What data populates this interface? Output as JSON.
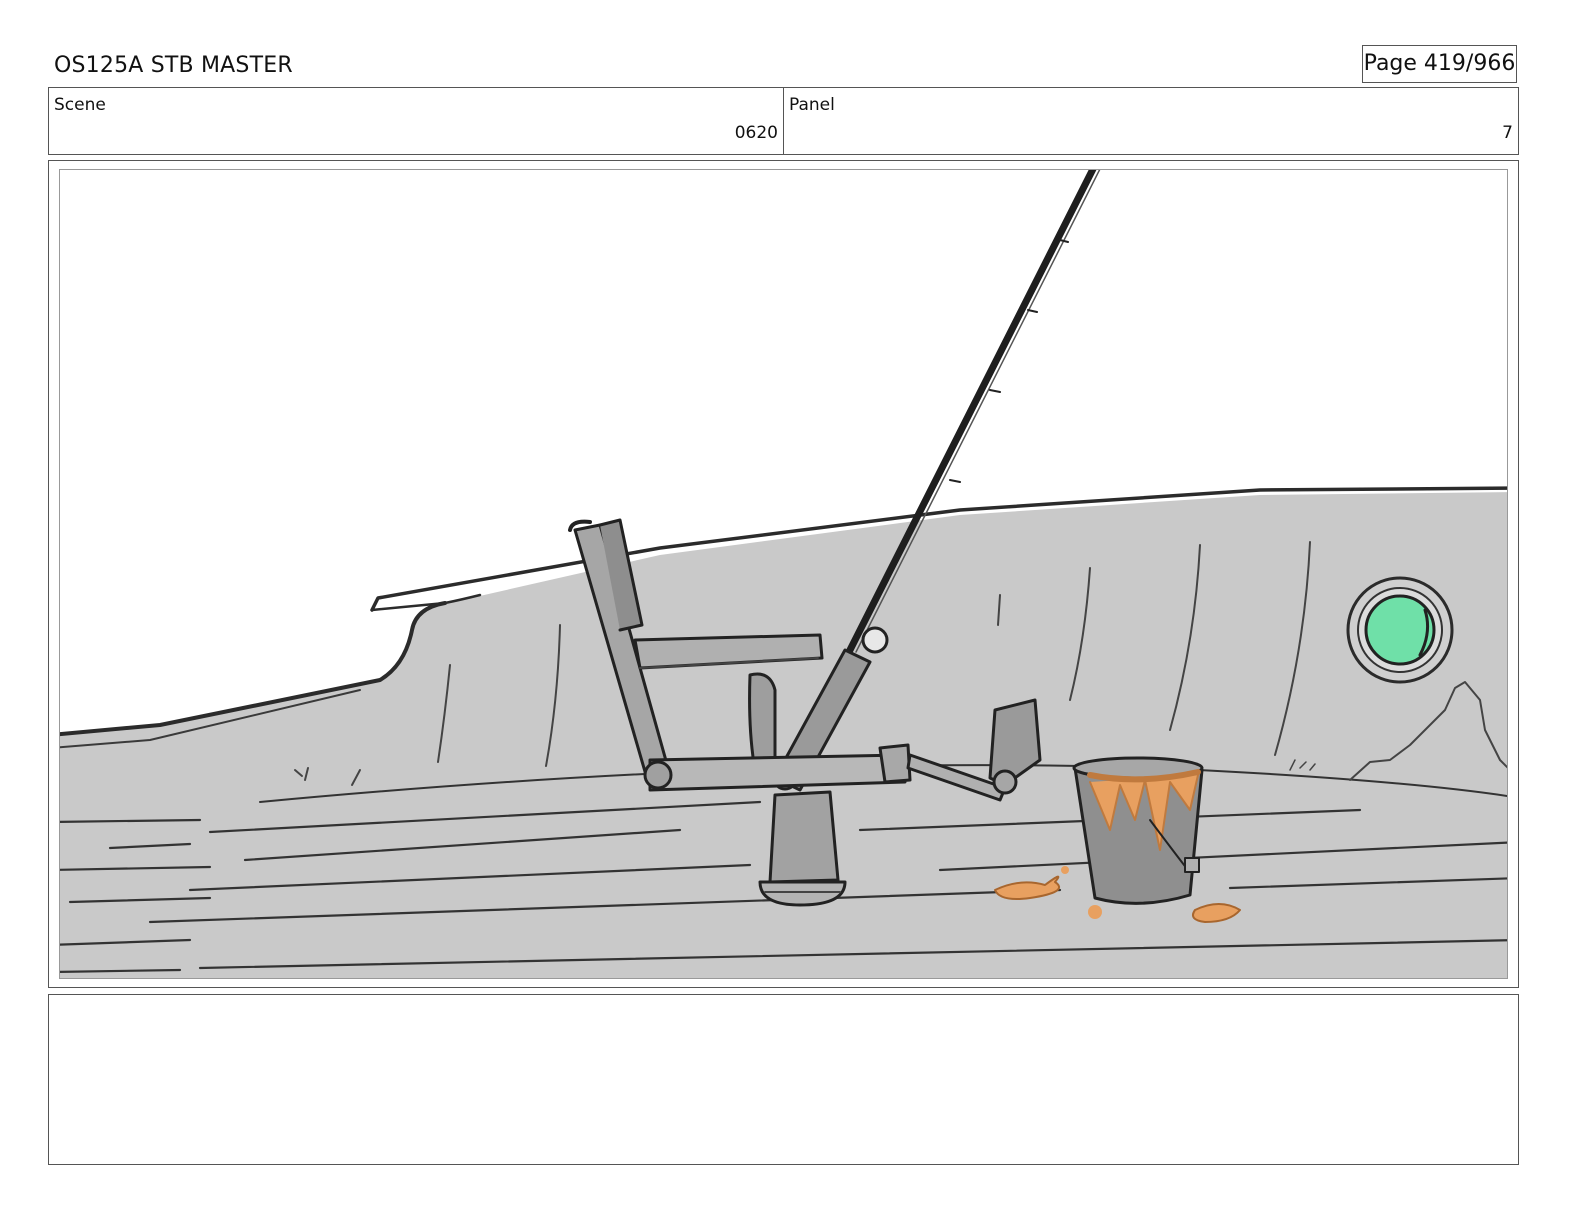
{
  "header": {
    "doc_title": "OS125A STB MASTER",
    "page_label": "Page 419/966"
  },
  "info": {
    "scene_label": "Scene",
    "scene_value": "0620",
    "panel_label": "Panel",
    "panel_value": "7"
  },
  "frame": {
    "illustration": "storyboard-sketch-boat-deck",
    "colors": {
      "hull": "#c9c9c9",
      "ink": "#2b2b2b",
      "porthole": "#6fe0a8",
      "paint": "#e8a060",
      "metal": "#9a9a9a"
    }
  },
  "notes": {
    "text": ""
  }
}
